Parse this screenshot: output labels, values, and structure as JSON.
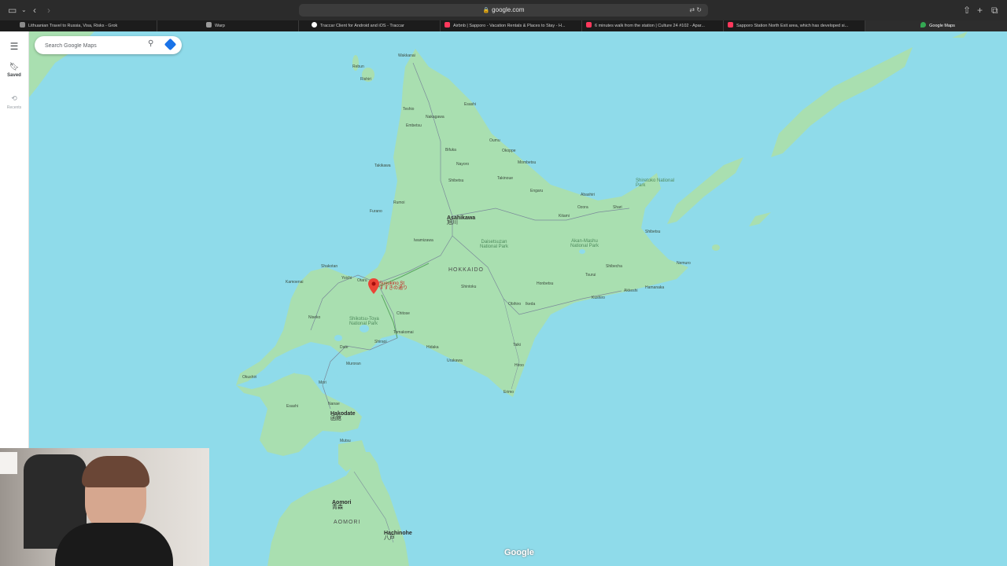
{
  "browser": {
    "url": "google.com",
    "tabs": [
      {
        "label": "Lithuanian Travel to Russia, Visa, Risks - Grok",
        "color": "#8a8a8a"
      },
      {
        "label": "Warp",
        "color": "#9a9a9a"
      },
      {
        "label": "Traccar Client for Android and iOS - Traccar",
        "color": "#ffffff"
      },
      {
        "label": "Airbnb | Sapporo - Vacation Rentals & Places to Stay - H...",
        "color": "#ff385c"
      },
      {
        "label": "6 minutes walk from the station | Culture 24 #102 - Apar...",
        "color": "#ff385c"
      },
      {
        "label": "Sapporo Station North Exit area, which has developed si...",
        "color": "#ff385c"
      },
      {
        "label": "Google Maps",
        "color": "#34a853"
      }
    ]
  },
  "sidebar": {
    "saved_label": "Saved",
    "recents_label": "Recents"
  },
  "search": {
    "placeholder": "Search Google Maps"
  },
  "map": {
    "pin_label": "Susukino St",
    "pin_label_jp": "すすきの通り",
    "watermark": "Google",
    "labels": {
      "asahikawa": "Asahikawa",
      "asahikawa_jp": "旭川",
      "hokkaido": "HOKKAIDO",
      "hakodate": "Hakodate",
      "hakodate_jp": "函館",
      "aomori": "Aomori",
      "aomori_jp": "青森",
      "aomori_pref": "AOMORI",
      "hachinohe": "Hachinohe",
      "hachinohe_jp": "八戸",
      "daisetsuzan": "Daisetsuzan National Park",
      "akan": "Akan-Mashu National Park",
      "shiretoko": "Shiretoko National Park",
      "shikotsu": "Shikotsu-Toya National Park",
      "wakkanai": "Wakkanai",
      "rumoi": "Rumoi",
      "otaru": "Otaru",
      "chitose": "Chitose",
      "tomakomai": "Tomakomai",
      "obihiro": "Obihiro",
      "kushiro": "Kushiro",
      "nemuro": "Nemuro",
      "abashiri": "Abashiri",
      "kitami": "Kitami",
      "mombetsu": "Mombetsu",
      "nayoro": "Nayoro",
      "muroran": "Muroran",
      "esashi": "Esashi",
      "shibetsu": "Shibetsu",
      "furano": "Furano",
      "takikawa": "Takikawa",
      "iwamizawa": "Iwamizawa",
      "erimo": "Erimo",
      "taiki": "Taiki",
      "hiroo": "Hiroo",
      "urakawa": "Urakawa",
      "shakotan": "Shakotan",
      "hidaka": "Hidaka",
      "rebun": "Rebun",
      "rishiri": "Rishiri",
      "teshio": "Teshio",
      "embetsu": "Embetsu",
      "nakagawa": "Nakagawa",
      "esashi_n": "Esashi",
      "oumu": "Oumu",
      "okoppe": "Okoppe",
      "bifuka": "Bifuka",
      "takinoue": "Takinoue",
      "engaru": "Engaru",
      "ozora": "Ozora",
      "shari": "Shari",
      "shibecha": "Shibecha",
      "akkeshi": "Akkeshi",
      "hamanaka": "Hamanaka",
      "tsurui": "Tsurui",
      "honbetsu": "Honbetsu",
      "ikeda": "Ikeda",
      "shintoku": "Shintoku",
      "mori": "Mori",
      "nanae": "Nanae",
      "okushiri": "Okushiri",
      "yoichi": "Yoichi",
      "kamoenai": "Kamoenai",
      "niseko": "Niseko",
      "date": "Date",
      "shiraoi": "Shiraoi",
      "mutsu": "Mutsu"
    }
  }
}
